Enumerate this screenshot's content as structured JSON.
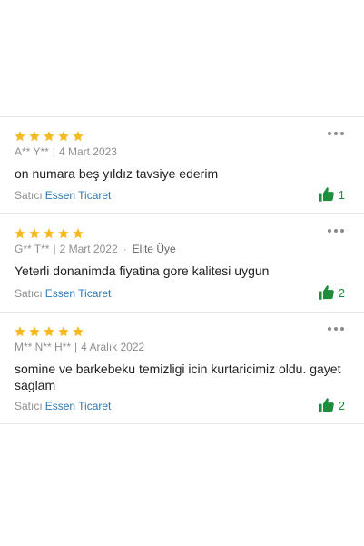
{
  "reviews": [
    {
      "rating": 5,
      "author": "A** Y**",
      "date": "4 Mart 2023",
      "badge": "",
      "text": "on numara beş yıldız tavsiye ederim",
      "seller_label": "Satıcı",
      "seller_name": "Essen Ticaret",
      "likes": "1"
    },
    {
      "rating": 5,
      "author": "G** T**",
      "date": "2 Mart 2022",
      "badge": "Elite Üye",
      "text": "Yeterli donanimda fiyatina gore kalitesi uygun",
      "seller_label": "Satıcı",
      "seller_name": "Essen Ticaret",
      "likes": "2"
    },
    {
      "rating": 5,
      "author": "M** N** H**",
      "date": "4 Aralık 2022",
      "badge": "",
      "text": "somine ve barkebeku temizligi icin kurtaricimiz oldu. gayet saglam",
      "seller_label": "Satıcı",
      "seller_name": "Essen Ticaret",
      "likes": "2"
    }
  ],
  "meta_separator": "|",
  "colors": {
    "star": "#f5b921",
    "like": "#1e8e3e",
    "seller_link": "#2c7ab8"
  },
  "icons": {
    "star": "star-icon",
    "more": "more-options-icon",
    "like": "thumbs-up-icon"
  }
}
